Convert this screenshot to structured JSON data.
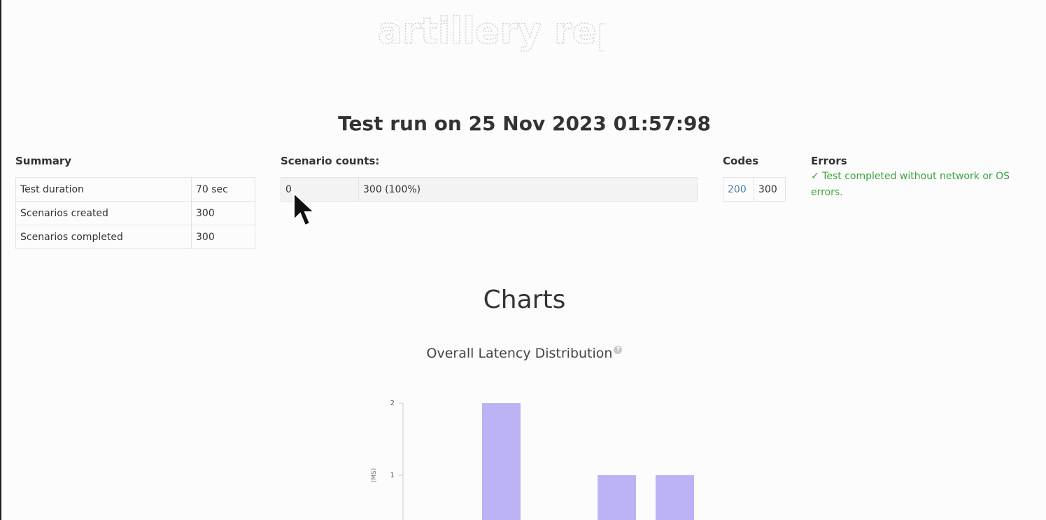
{
  "logo": {
    "text": "artillery report"
  },
  "title": "Test run on 25 Nov 2023 01:57:98",
  "summary": {
    "label": "Summary",
    "rows": [
      {
        "key": "Test duration",
        "value": "70 sec"
      },
      {
        "key": "Scenarios created",
        "value": "300"
      },
      {
        "key": "Scenarios completed",
        "value": "300"
      }
    ]
  },
  "scenario_counts": {
    "label": "Scenario counts:",
    "rows": [
      {
        "key": "0",
        "value": "300 (100%)"
      }
    ]
  },
  "codes": {
    "label": "Codes",
    "rows": [
      {
        "code": "200",
        "count": "300"
      }
    ]
  },
  "errors": {
    "label": "Errors",
    "message": "✓ Test completed without network or OS errors."
  },
  "charts": {
    "heading": "Charts",
    "latency": {
      "title": "Overall Latency Distribution",
      "help_icon": "question-circle-icon"
    }
  },
  "chart_data": {
    "type": "bar",
    "title": "Overall Latency Distribution",
    "ylabel": "(MS)",
    "xlabel": "",
    "yticks": [
      1,
      2
    ],
    "ylim": [
      0,
      2
    ],
    "values": [
      2,
      1,
      1
    ],
    "bar_color": "#bbb3f3"
  },
  "colors": {
    "code_link": "#4a7fb5",
    "success": "#3aa33a",
    "bar": "#bbb3f3"
  }
}
